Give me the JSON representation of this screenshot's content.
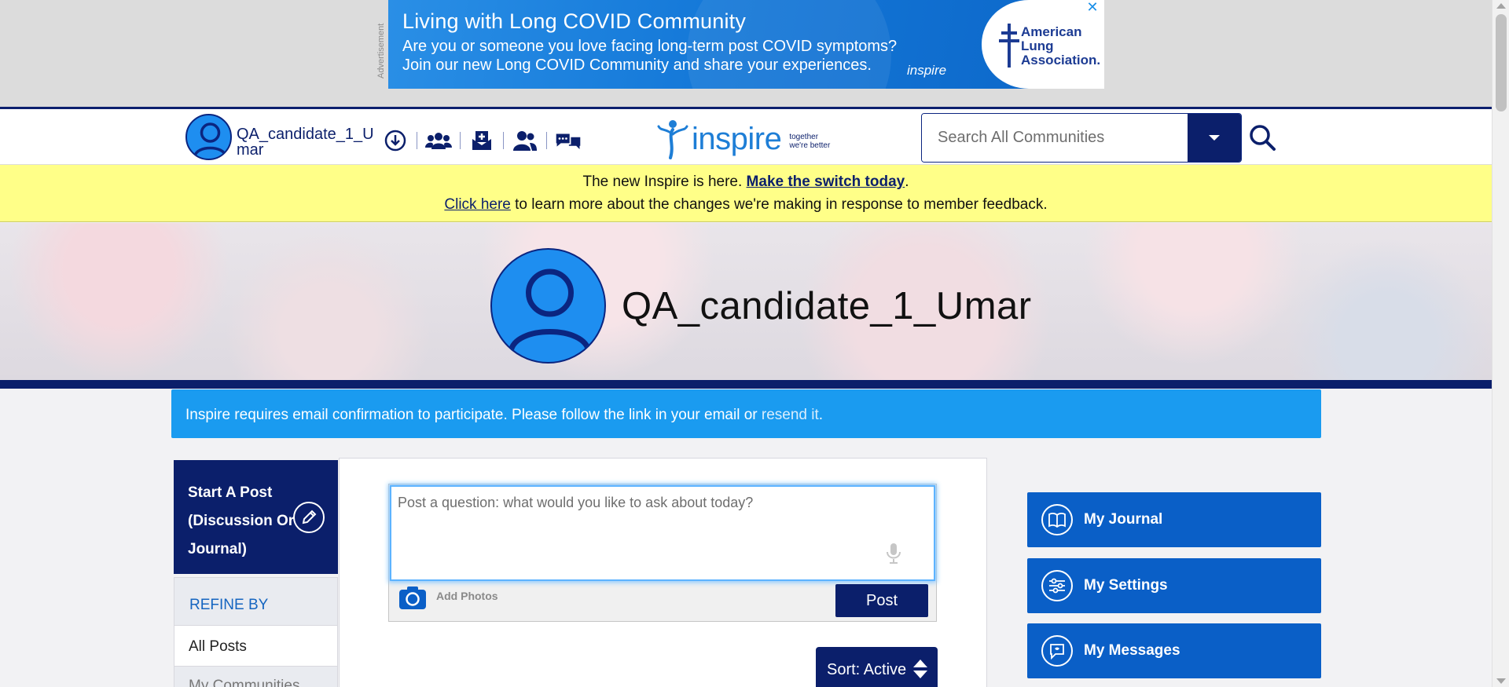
{
  "ad": {
    "vertical_label": "Advertisement",
    "title": "Living with Long COVID Community",
    "line1": "Are you or someone you love facing long-term post COVID symptoms?",
    "line2": "Join our new Long COVID Community and share your experiences.",
    "inspire_mark": "inspire",
    "sponsor": "American Lung Association.",
    "close": "✕"
  },
  "header": {
    "username": "QA_candidate_1_Umar",
    "icons": [
      "download-icon",
      "groups-icon",
      "inbox-icon",
      "people-icon",
      "chat-icon"
    ],
    "logo_text": "inspire",
    "logo_tagline_1": "together",
    "logo_tagline_2": "we're better",
    "search_placeholder": "Search All Communities"
  },
  "notice": {
    "line1_prefix": "The new Inspire is here. ",
    "line1_link": "Make the switch today",
    "line1_suffix": ".",
    "line2_link": "Click here",
    "line2_suffix": " to learn more about the changes we're making in response to member feedback."
  },
  "profile": {
    "name": "QA_candidate_1_Umar"
  },
  "email_banner": {
    "text": "Inspire requires email confirmation to participate. Please follow the link in your email or ",
    "link": "resend it",
    "suffix": "."
  },
  "left_nav": {
    "start_post": "Start A Post (Discussion Or Journal)",
    "refine_by": "REFINE BY",
    "all_posts": "All Posts",
    "my_communities": "My Communities"
  },
  "composer": {
    "placeholder": "Post a question: what would you like to ask about today?",
    "add_photos": "Add Photos",
    "post_button": "Post",
    "sort_label": "Sort: Active"
  },
  "right_nav": {
    "items": [
      {
        "label": "My Journal",
        "icon": "journal-icon"
      },
      {
        "label": "My Settings",
        "icon": "settings-icon"
      },
      {
        "label": "My Messages",
        "icon": "messages-icon"
      }
    ]
  },
  "colors": {
    "navy": "#0b1f6b",
    "brand_blue": "#1e8ef0",
    "side_button_blue": "#0a5fc7",
    "notice_yellow": "#ffff88",
    "email_banner_blue": "#1a9bf0"
  }
}
